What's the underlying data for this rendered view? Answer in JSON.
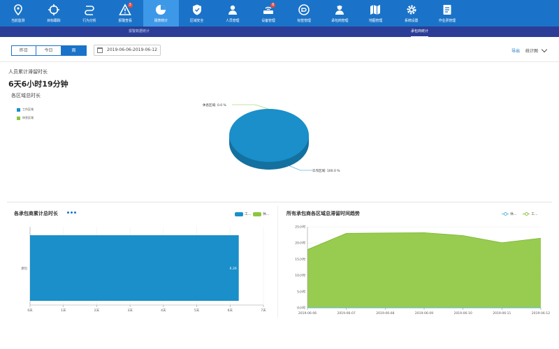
{
  "nav": {
    "items": [
      {
        "label": "当前监测",
        "icon": "location-pin-icon"
      },
      {
        "label": "目标跟踪",
        "icon": "crosshair-icon"
      },
      {
        "label": "行为分析",
        "icon": "route-icon"
      },
      {
        "label": "报警查看",
        "icon": "warning-icon",
        "badge": "3"
      },
      {
        "label": "报表统计",
        "icon": "pie-chart-icon",
        "active": true
      },
      {
        "label": "区域安全",
        "icon": "shield-icon"
      },
      {
        "label": "人员管理",
        "icon": "person-icon"
      },
      {
        "label": "设备管理",
        "icon": "router-icon",
        "badge": "6"
      },
      {
        "label": "标签管理",
        "icon": "tag-icon"
      },
      {
        "label": "承包商管理",
        "icon": "worker-icon"
      },
      {
        "label": "地图管理",
        "icon": "map-icon"
      },
      {
        "label": "系统设置",
        "icon": "gear-icon"
      },
      {
        "label": "作业票管理",
        "icon": "document-icon"
      }
    ]
  },
  "subnav": {
    "tabs": [
      {
        "label": "报警数据统计",
        "active": false
      },
      {
        "label": "承包商统计",
        "active": true
      }
    ]
  },
  "filter": {
    "segments": [
      {
        "label": "昨日",
        "active": false
      },
      {
        "label": "今日",
        "active": false
      },
      {
        "label": "周",
        "active": true
      }
    ],
    "date_range": "2019-06-06-2019-06-12",
    "export_label": "导出",
    "stats_label": "统计图"
  },
  "summary": {
    "label": "人员累计滞留时长",
    "value": "6天6小时19分钟",
    "section_title": "各区域总时长"
  },
  "colors": {
    "blue": "#1a8fc9",
    "green": "#8cc63e",
    "nav": "#1a73c8"
  },
  "pie": {
    "legend": [
      "工作区域",
      "休息区域"
    ],
    "label_rest": "休息区域: 0.0 %",
    "label_work": "工作区域: 100.0 %"
  },
  "bar_panel": {
    "title": "各承包商累计总时长",
    "legend": [
      "工...",
      "休..."
    ]
  },
  "area_panel": {
    "title": "所有承包商各区域总滞留时间趋势",
    "legend": [
      "休...",
      "工..."
    ]
  },
  "chart_data": [
    {
      "type": "pie",
      "title": "各区域总时长",
      "slices": [
        {
          "name": "工作区域",
          "value": 100.0
        },
        {
          "name": "休息区域",
          "value": 0.0
        }
      ]
    },
    {
      "type": "bar",
      "title": "各承包商累计总时长",
      "orientation": "horizontal",
      "categories": [
        "承包"
      ],
      "series": [
        {
          "name": "工...",
          "values": [
            6.26
          ]
        },
        {
          "name": "休...",
          "values": [
            0
          ]
        }
      ],
      "data_label": "6.26",
      "xticks": [
        "0天",
        "1天",
        "2天",
        "3天",
        "4天",
        "5天",
        "6天",
        "7天"
      ],
      "xlim": [
        0,
        7
      ]
    },
    {
      "type": "area",
      "title": "所有承包商各区域总滞留时间趋势",
      "x": [
        "2019-06-06",
        "2019-06-07",
        "2019-06-08",
        "2019-06-09",
        "2019-06-10",
        "2019-06-11",
        "2019-06-12"
      ],
      "series": [
        {
          "name": "工...",
          "values": [
            18,
            23,
            23.1,
            23.2,
            22.3,
            20.1,
            21.5
          ]
        },
        {
          "name": "休...",
          "values": [
            0,
            0,
            0,
            0,
            0,
            0,
            0
          ]
        }
      ],
      "yticks": [
        "0小时",
        "5小时",
        "10小时",
        "15小时",
        "20小时",
        "25小时"
      ],
      "ylim": [
        0,
        25
      ]
    }
  ]
}
